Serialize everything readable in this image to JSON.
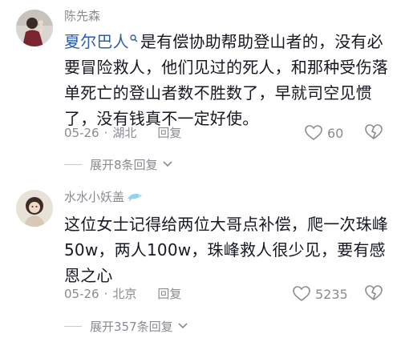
{
  "comments": [
    {
      "username": "陈先森",
      "mention": "夏尔巴人",
      "text": "是有偿协助帮助登山者的，没有必要冒险救人，他们见过的死人，和那种受伤落单死亡的登山者数不胜数了，早就司空见惯了，没有钱真不一定好使。",
      "date": "05-26",
      "location": "湖北",
      "reply_label": "回复",
      "likes": "60",
      "expand_label": "展开8条回复"
    },
    {
      "username": "水水小妖盖",
      "text": "这位女士记得给两位大哥点补偿，爬一次珠峰50w，两人100w，珠峰救人很少见，要有感恩之心",
      "date": "05-26",
      "location": "北京",
      "reply_label": "回复",
      "likes": "5235",
      "expand_label": "展开357条回复"
    }
  ],
  "colors": {
    "mention": "#2f5da8",
    "meta": "#8a8b91",
    "text": "#161823"
  }
}
